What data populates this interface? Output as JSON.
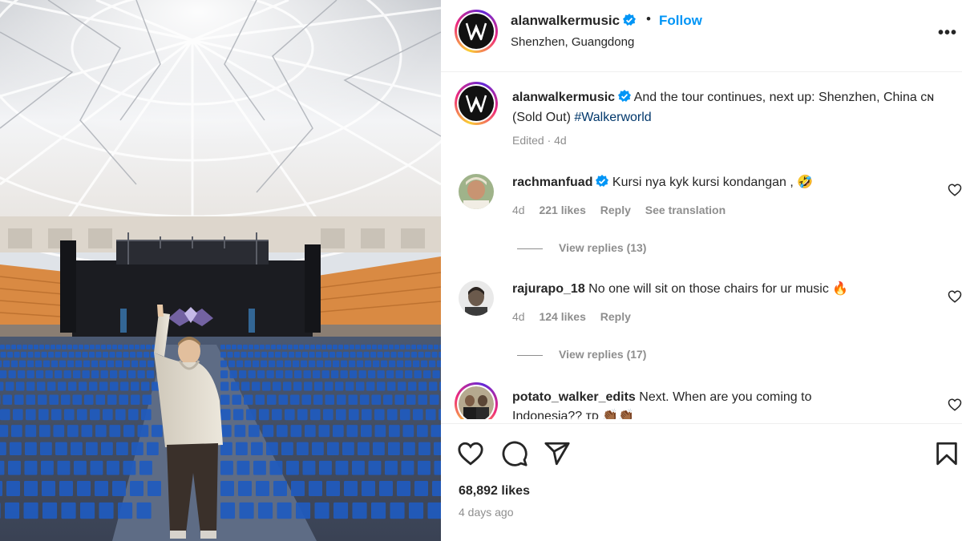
{
  "post": {
    "username": "alanwalkermusic",
    "follow_label": "Follow",
    "dot": "•",
    "location": "Shenzhen, Guangdong",
    "more_label": "•••"
  },
  "caption": {
    "username": "alanwalkermusic",
    "text_part1": "And the tour continues, next up: Shenzhen, China ᴄɴ (Sold Out) ",
    "hashtag": "#Walkerworld",
    "meta": "Edited · 4d"
  },
  "comments": [
    {
      "username": "rachmanfuad",
      "verified": true,
      "text": "Kursi nya kyk kursi kondangan , 🤣",
      "age": "4d",
      "likes": "221 likes",
      "reply": "Reply",
      "see_translation": "See translation",
      "view_replies": "View replies (13)"
    },
    {
      "username": "rajurapo_18",
      "verified": false,
      "text": "No one will sit on those chairs for ur music 🔥",
      "age": "4d",
      "likes": "124 likes",
      "reply": "Reply",
      "view_replies": "View replies (17)"
    },
    {
      "username": "potato_walker_edits",
      "verified": false,
      "text": "Next. When are you coming to Indonesia?? ᴛᴅ 👏🏾👏🏾"
    }
  ],
  "footer": {
    "likes": "68,892 likes",
    "time": "4 days ago"
  },
  "icons": {
    "verified": "verified-badge-icon",
    "like": "heart-icon",
    "comment": "comment-icon",
    "share": "share-icon",
    "save": "bookmark-icon",
    "more": "more-options-icon"
  },
  "colors": {
    "follow": "#0095f6",
    "verified": "#0095f6",
    "hashtag": "#00376b",
    "muted": "#8e8e8e",
    "seats": "#1f5bbf"
  }
}
